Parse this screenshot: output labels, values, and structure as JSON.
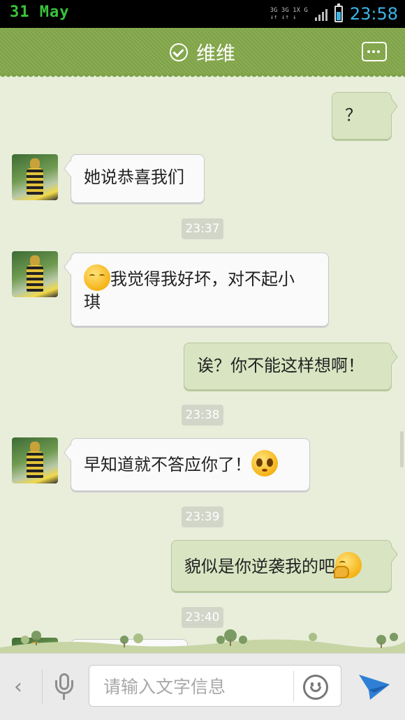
{
  "status_bar": {
    "date": "31 May",
    "network_top": "3G 3G 1X G",
    "network_bottom": "↓↑ ↓↑ ↓",
    "time": "23:58"
  },
  "header": {
    "contact_name": "维维",
    "menu_icon": "more-dots-icon"
  },
  "messages": [
    {
      "type": "out",
      "text": "？"
    },
    {
      "type": "in",
      "text": "她说恭喜我们"
    },
    {
      "type": "time",
      "text": "23:37"
    },
    {
      "type": "in",
      "emoji": "sad",
      "text_line1": "我觉得我好坏，对不起小",
      "text_line2": "琪"
    },
    {
      "type": "out",
      "text": "诶？你不能这样想啊！"
    },
    {
      "type": "time",
      "text": "23:38"
    },
    {
      "type": "in",
      "text": "早知道就不答应你了！",
      "emoji": "crying"
    },
    {
      "type": "time",
      "text": "23:39"
    },
    {
      "type": "out",
      "text": "貌似是你逆袭我的吧",
      "emoji": "shy"
    },
    {
      "type": "time",
      "text": "23:40"
    }
  ],
  "input_bar": {
    "back_label": "‹",
    "placeholder": "请输入文字信息"
  },
  "colors": {
    "header_green": "#8aac52",
    "chat_bg": "#e9eedb",
    "bubble_out": "#d9e5c2",
    "bubble_in": "#fafafa",
    "time_cyan": "#3bb5e8",
    "date_green": "#39c43c",
    "send_blue": "#2f7fd6"
  }
}
